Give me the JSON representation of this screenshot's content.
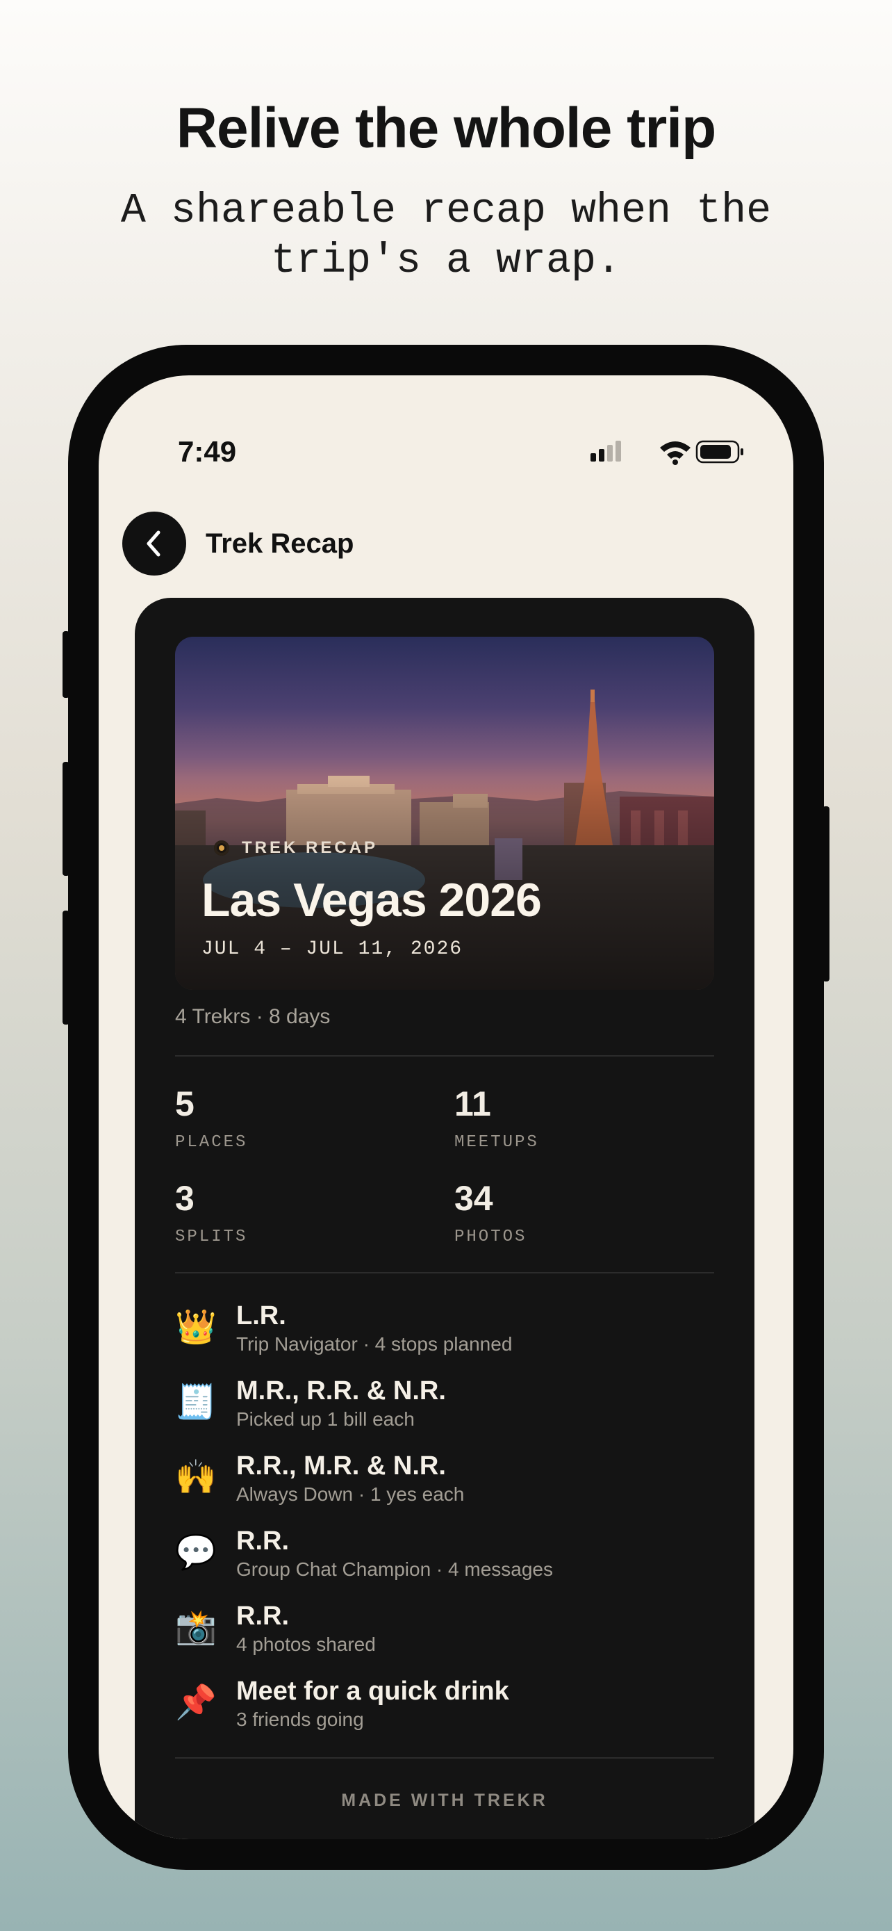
{
  "marketing": {
    "headline": "Relive the whole trip",
    "subline": "A shareable recap when the trip's a wrap."
  },
  "status_bar": {
    "time": "7:49",
    "icons": [
      "cellular-signal-icon",
      "wifi-icon",
      "battery-icon"
    ]
  },
  "nav": {
    "back_icon": "chevron-left-icon",
    "title": "Trek Recap"
  },
  "recap": {
    "kicker": "TREK RECAP",
    "title": "Las Vegas 2026",
    "dates": "JUL 4 – JUL 11, 2026",
    "summary": "4 Trekrs · 8 days",
    "stats": [
      {
        "value": "5",
        "label": "PLACES"
      },
      {
        "value": "11",
        "label": "MEETUPS"
      },
      {
        "value": "3",
        "label": "SPLITS"
      },
      {
        "value": "34",
        "label": "PHOTOS"
      }
    ],
    "awards": [
      {
        "icon": "crown-icon",
        "glyph": "👑",
        "title": "L.R.",
        "subtitle": "Trip Navigator · 4 stops planned"
      },
      {
        "icon": "receipt-icon",
        "glyph": "🧾",
        "title": "M.R., R.R. & N.R.",
        "subtitle": "Picked up 1 bill each"
      },
      {
        "icon": "raised-hands-icon",
        "glyph": "🙌",
        "title": "R.R., M.R. & N.R.",
        "subtitle": "Always Down · 1 yes each"
      },
      {
        "icon": "speech-bubble-icon",
        "glyph": "💬",
        "title": "R.R.",
        "subtitle": "Group Chat Champion · 4 messages"
      },
      {
        "icon": "camera-flash-icon",
        "glyph": "📸",
        "title": "R.R.",
        "subtitle": "4 photos shared"
      },
      {
        "icon": "pushpin-icon",
        "glyph": "📌",
        "title": "Meet for a quick drink",
        "subtitle": "3 friends going"
      }
    ],
    "footer": "MADE WITH TREKR"
  },
  "colors": {
    "card_bg": "#141414",
    "screen_bg": "#f4efe6",
    "accent_gold": "#d9a24a"
  }
}
